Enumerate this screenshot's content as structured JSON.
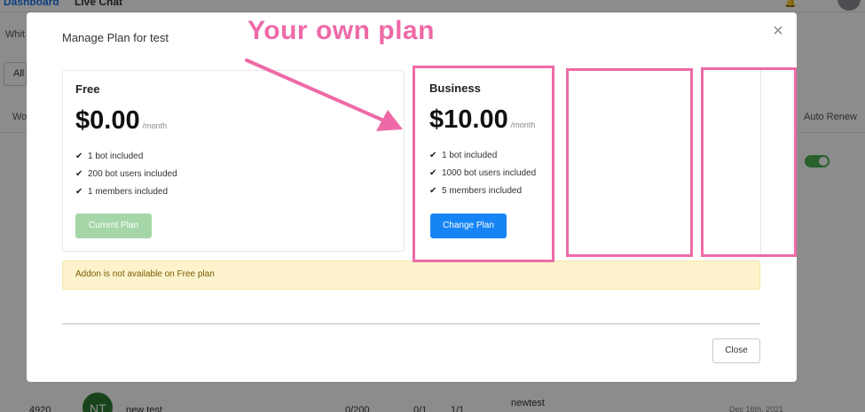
{
  "background": {
    "tabs": [
      "Dashboard",
      "Live Chat"
    ],
    "label_white": "Whit",
    "filter_all": "All",
    "columns": {
      "wo": "Wo",
      "auto_renew": "Auto Renew"
    },
    "row": {
      "id": "4920",
      "avatar_initials": "NT",
      "name": "new test",
      "bots": "0/200",
      "members": "0/1",
      "ratio": "1/1",
      "plan": "newtest",
      "date": "Dec 16th, 2021"
    }
  },
  "modal": {
    "title": "Manage Plan for test",
    "close_icon": "×",
    "plans": [
      {
        "name": "Free",
        "price": "$0.00",
        "period": "/month",
        "features": [
          "1 bot included",
          "200 bot users included",
          "1 members included"
        ],
        "button": "Current Plan"
      },
      {
        "name": "Business",
        "price": "$10.00",
        "period": "/month",
        "features": [
          "1 bot included",
          "1000 bot users included",
          "5 members included"
        ],
        "button": "Change Plan"
      }
    ],
    "addon_notice": "Addon is not available on Free plan",
    "close_button": "Close"
  },
  "annotation": {
    "text": "Your own plan",
    "color": "#ee6aa7"
  },
  "colors": {
    "primary_button": "#1784f5",
    "current_plan_button": "#a5d6a7",
    "notice_bg": "#fcf3cd",
    "toggle_on": "#4caf50"
  }
}
